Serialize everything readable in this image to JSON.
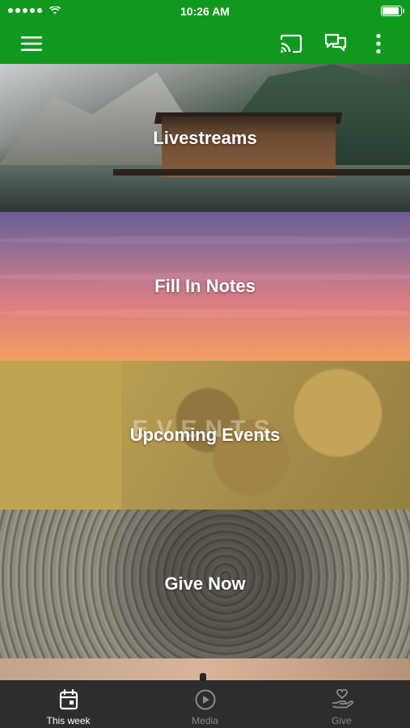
{
  "status_bar": {
    "time": "10:26 AM",
    "signal_dots": 5,
    "battery_level": 0.9
  },
  "toolbar": {
    "icons": [
      "menu-icon",
      "cast-icon",
      "chat-icon",
      "more-icon"
    ]
  },
  "tiles": [
    {
      "label": "Livestreams"
    },
    {
      "label": "Fill In Notes"
    },
    {
      "label": "Upcoming Events",
      "watermark": "EVENTS"
    },
    {
      "label": "Give Now"
    }
  ],
  "tabs": [
    {
      "label": "This week",
      "icon": "calendar-icon",
      "active": true
    },
    {
      "label": "Media",
      "icon": "play-circle-icon",
      "active": false
    },
    {
      "label": "Give",
      "icon": "heart-hand-icon",
      "active": false
    }
  ],
  "colors": {
    "app_bar": "#0f9a1f",
    "tab_bar": "#2d2d2d",
    "tab_active": "#ffffff",
    "tab_inactive": "#8a8a8a"
  }
}
